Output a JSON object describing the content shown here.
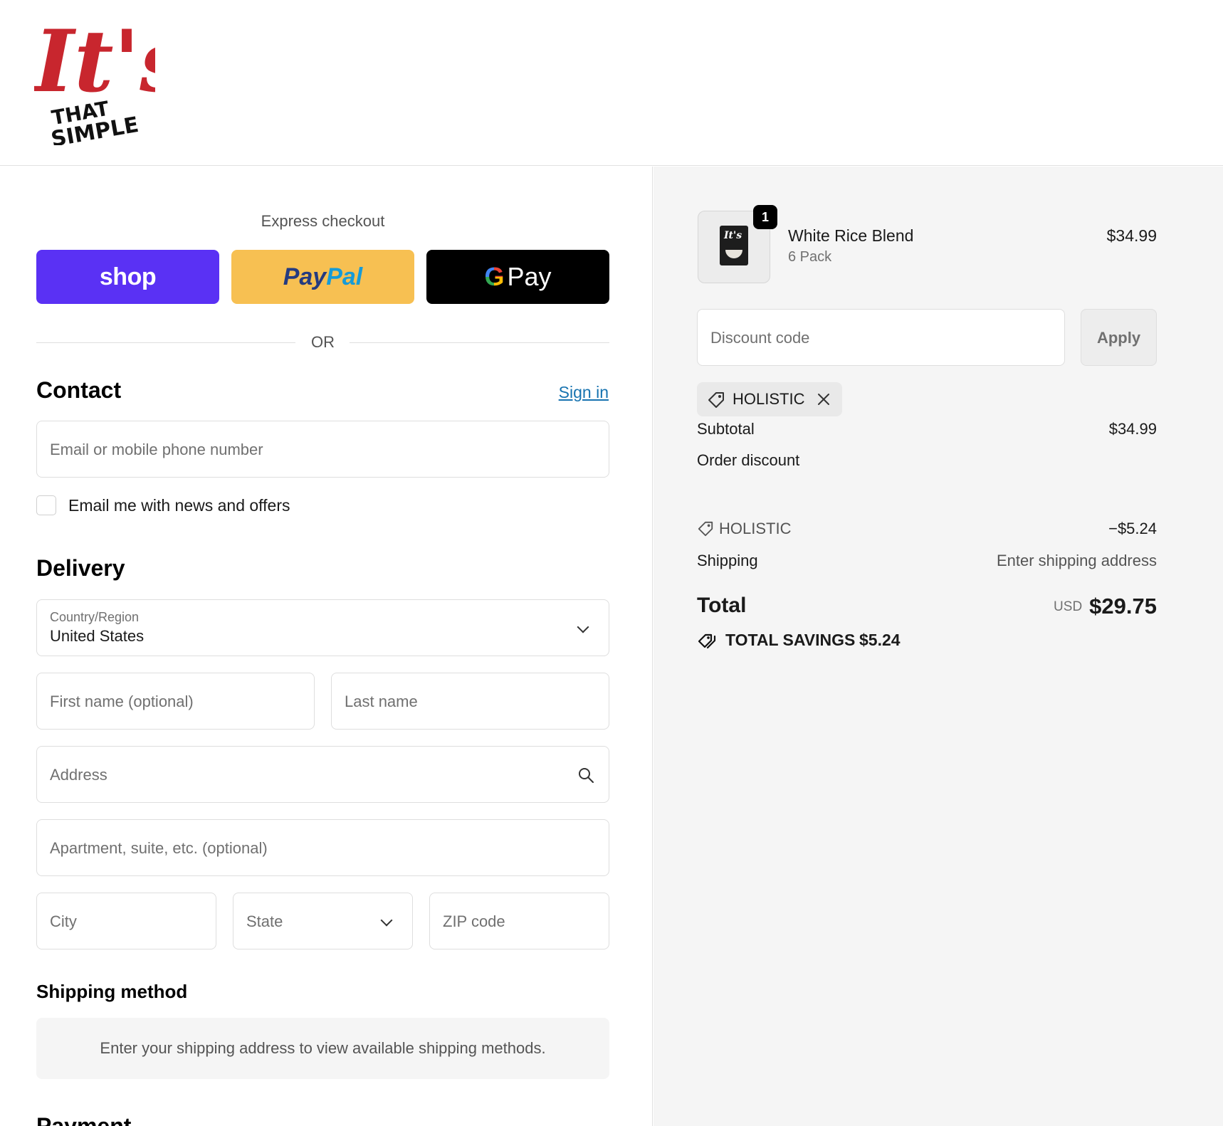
{
  "brand": {
    "logo_text_script": "It's",
    "logo_text_line1": "THAT",
    "logo_text_line2": "SIMPLE",
    "colors": {
      "script_red": "#c8262e",
      "text_black": "#111111"
    }
  },
  "express": {
    "label": "Express checkout",
    "shop_label": "shop",
    "paypal_part1": "Pay",
    "paypal_part2": "Pal",
    "gpay_g": "G",
    "gpay_label": "Pay",
    "or_label": "OR"
  },
  "contact": {
    "title": "Contact",
    "sign_in": "Sign in",
    "email_placeholder": "Email or mobile phone number",
    "newsletter_label": "Email me with news and offers",
    "newsletter_checked": false
  },
  "delivery": {
    "title": "Delivery",
    "country_label": "Country/Region",
    "country_value": "United States",
    "first_name_placeholder": "First name (optional)",
    "last_name_placeholder": "Last name",
    "address_placeholder": "Address",
    "apartment_placeholder": "Apartment, suite, etc. (optional)",
    "city_placeholder": "City",
    "state_placeholder": "State",
    "zip_placeholder": "ZIP code"
  },
  "shipping_method": {
    "title": "Shipping method",
    "message": "Enter your shipping address to view available shipping methods."
  },
  "payment": {
    "title_peek": "Payment"
  },
  "order": {
    "item": {
      "name": "White Rice Blend",
      "variant": "6 Pack",
      "price": "$34.99",
      "quantity": "1",
      "thumb_label": "It's"
    },
    "discount_placeholder": "Discount code",
    "apply_label": "Apply",
    "applied_code": "HOLISTIC",
    "subtotal_label": "Subtotal",
    "subtotal_value": "$34.99",
    "order_discount_label": "Order discount",
    "discount_code_label": "HOLISTIC",
    "discount_value": "−$5.24",
    "shipping_label": "Shipping",
    "shipping_value": "Enter shipping address",
    "total_label": "Total",
    "total_currency": "USD",
    "total_value": "$29.75",
    "savings_label": "TOTAL SAVINGS",
    "savings_value": "$5.24"
  },
  "colors": {
    "shop_purple": "#5a31f4",
    "paypal_yellow": "#f7c052",
    "gpay_black": "#000000",
    "link_blue": "#1773b0",
    "summary_bg": "#f5f5f5"
  }
}
